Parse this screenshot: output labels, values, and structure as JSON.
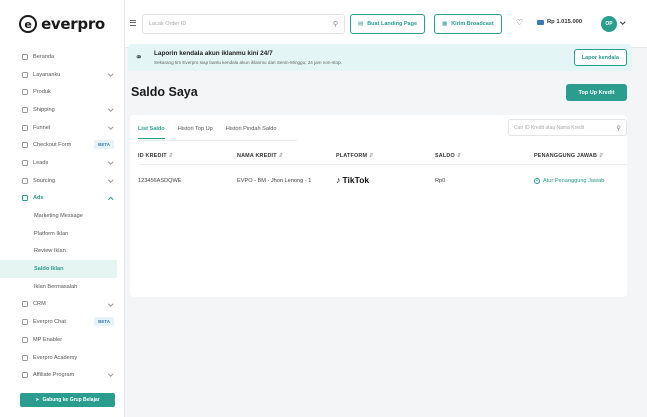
{
  "brand": {
    "logo_letter": "e",
    "name": "everpro"
  },
  "sidebar": {
    "items": [
      {
        "label": "Beranda",
        "icon": "home-icon"
      },
      {
        "label": "Layananku",
        "icon": "layers-icon",
        "chevron": true
      },
      {
        "label": "Produk",
        "icon": "box-icon"
      },
      {
        "label": "Shipping",
        "icon": "truck-icon",
        "chevron": true
      },
      {
        "label": "Funnel",
        "icon": "funnel-icon",
        "chevron": true
      },
      {
        "label": "Checkout Form",
        "icon": "form-icon",
        "badge": "BETA"
      },
      {
        "label": "Leads",
        "icon": "users-icon",
        "chevron": true
      },
      {
        "label": "Sourcing",
        "icon": "search-icon",
        "chevron": true
      },
      {
        "label": "Ads",
        "icon": "megaphone-icon",
        "chevron": true,
        "expanded": true
      },
      {
        "label": "Marketing Message",
        "sub": true
      },
      {
        "label": "Platform Iklan",
        "sub": true
      },
      {
        "label": "Review Iklan",
        "sub": true
      },
      {
        "label": "Saldo Iklan",
        "sub": true,
        "selected": true
      },
      {
        "label": "Iklan Bermasalah",
        "sub": true
      },
      {
        "label": "CRM",
        "icon": "crm-icon",
        "chevron": true
      },
      {
        "label": "Everpro Chat",
        "icon": "chat-icon",
        "badge": "BETA"
      },
      {
        "label": "MP Enabler",
        "icon": "store-icon"
      },
      {
        "label": "Everpro Academy",
        "icon": "academy-icon"
      },
      {
        "label": "Affiliate Program",
        "icon": "affiliate-icon",
        "chevron": true
      }
    ],
    "join_button": "Gabung ke Grup Belajar"
  },
  "topbar": {
    "search_placeholder": "Lacak Order ID",
    "landing_button": "Buat Landing Page",
    "broadcast_button": "Kirim Broadcast",
    "balance": "Rp 1.015.000",
    "avatar_initials": "OP"
  },
  "banner": {
    "title": "Laporin kendala akun iklanmu kini 24/7",
    "description": "Sekarang tim Everpro siap bantu kendala akun iklanmu dari Senin-Minggu, 24 jam non-stop.",
    "button": "Lapor kendala"
  },
  "main": {
    "title": "Saldo Saya",
    "topup_button": "Top Up Kredit",
    "tabs": [
      "List Saldo",
      "Histori Top Up",
      "Histori Pindah Saldo"
    ],
    "search_placeholder": "Cari ID Kredit atau Nama Kredit",
    "columns": [
      "ID KREDIT",
      "NAMA KREDIT",
      "PLATFORM",
      "SALDO",
      "PENANGGUNG JAWAB"
    ],
    "rows": [
      {
        "id": "123456ASDQWE",
        "name": "EVPO - BM - Jhon Lenong - 1",
        "platform": "TikTok",
        "saldo": "Rp0",
        "assign": "Atur Penanggung Jawab"
      }
    ]
  },
  "colors": {
    "accent": "#2a9d8f",
    "banner_bg": "#e3f5f4"
  }
}
